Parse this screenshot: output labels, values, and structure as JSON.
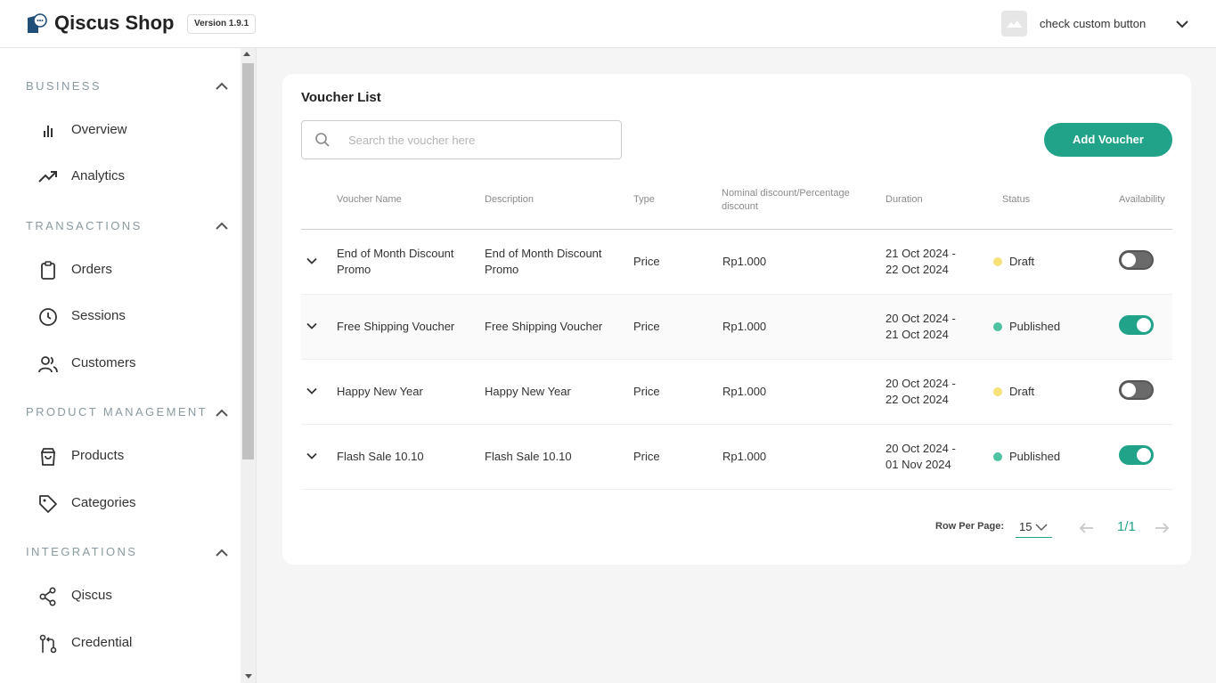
{
  "header": {
    "brand": "Qiscus Shop",
    "version": "Version 1.9.1",
    "user_name": "check custom button",
    "avatar_icon": "image-placeholder-icon",
    "menu_icon": "chevron-down-icon"
  },
  "sidebar": {
    "sections": [
      {
        "title": "BUSINESS",
        "items": [
          {
            "label": "Overview",
            "icon": "bar-chart-icon"
          },
          {
            "label": "Analytics",
            "icon": "trending-up-icon"
          }
        ]
      },
      {
        "title": "TRANSACTIONS",
        "items": [
          {
            "label": "Orders",
            "icon": "clipboard-icon"
          },
          {
            "label": "Sessions",
            "icon": "clock-icon"
          },
          {
            "label": "Customers",
            "icon": "users-icon"
          }
        ]
      },
      {
        "title": "PRODUCT MANAGEMENT",
        "items": [
          {
            "label": "Products",
            "icon": "shopping-bag-icon"
          },
          {
            "label": "Categories",
            "icon": "tag-icon"
          }
        ]
      },
      {
        "title": "INTEGRATIONS",
        "items": [
          {
            "label": "Qiscus",
            "icon": "share-icon"
          },
          {
            "label": "Credential",
            "icon": "git-pull-icon"
          }
        ]
      }
    ]
  },
  "main": {
    "title": "Voucher List",
    "search_placeholder": "Search the voucher here",
    "add_button": "Add Voucher",
    "columns": {
      "name": "Voucher Name",
      "description": "Description",
      "type": "Type",
      "discount": "Nominal discount/Percentage discount",
      "duration": "Duration",
      "status": "Status",
      "availability": "Availability"
    },
    "rows": [
      {
        "name": "End of Month Discount Promo",
        "description": "End of Month Discount Promo",
        "type": "Price",
        "discount": "Rp1.000",
        "duration_start": "21 Oct 2024 -",
        "duration_end": "22 Oct 2024",
        "status": "Draft",
        "status_color": "#f7e27a",
        "available": false
      },
      {
        "name": "Free Shipping Voucher",
        "description": "Free Shipping Voucher",
        "type": "Price",
        "discount": "Rp1.000",
        "duration_start": "20 Oct 2024 -",
        "duration_end": "21 Oct 2024",
        "status": "Published",
        "status_color": "#4fc3a1",
        "available": true
      },
      {
        "name": "Happy New Year",
        "description": "Happy New Year",
        "type": "Price",
        "discount": "Rp1.000",
        "duration_start": "20 Oct 2024 -",
        "duration_end": "22 Oct 2024",
        "status": "Draft",
        "status_color": "#f7e27a",
        "available": false
      },
      {
        "name": "Flash Sale 10.10",
        "description": "Flash Sale 10.10",
        "type": "Price",
        "discount": "Rp1.000",
        "duration_start": "20 Oct 2024 -",
        "duration_end": "01 Nov 2024",
        "status": "Published",
        "status_color": "#4fc3a1",
        "available": true
      }
    ],
    "pager": {
      "rows_per_page_label": "Row Per Page:",
      "rows_per_page": "15",
      "page": "1/1"
    }
  },
  "colors": {
    "accent": "#21a38a",
    "brand_icon": "#1f4e79"
  }
}
